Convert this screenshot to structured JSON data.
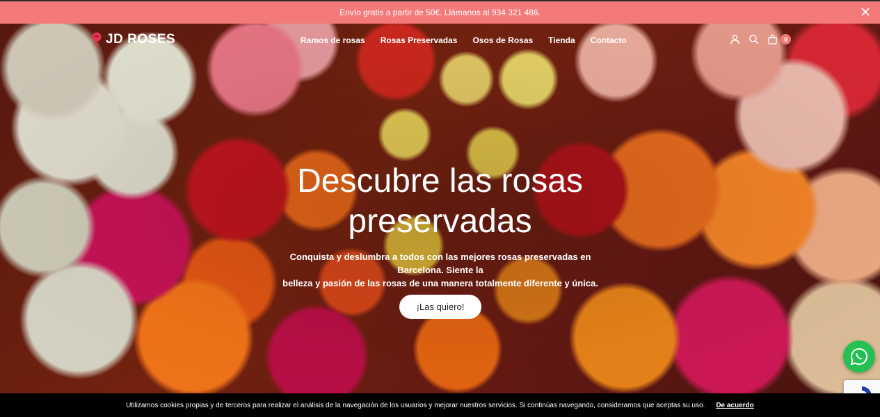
{
  "topbar": {
    "text": "Envío gratis a partir de 50€. Llámanos al 934 321 486."
  },
  "header": {
    "logo_text": "JD ROSES",
    "nav": [
      {
        "label": "Ramos de rosas"
      },
      {
        "label": "Rosas Preservadas"
      },
      {
        "label": "Osos de Rosas"
      },
      {
        "label": "Tienda"
      },
      {
        "label": "Contacto"
      }
    ],
    "cart_count": "0"
  },
  "hero": {
    "title_line1": "Descubre las rosas",
    "title_line2": "preservadas",
    "subtitle_line1": "Conquista y deslumbra a todos con las mejores rosas preservadas en Barcelona. Siente la",
    "subtitle_line2": "belleza y pasión de las rosas de una manera totalmente diferente y única.",
    "cta_label": "¡Las quiero!"
  },
  "cookie": {
    "text": "Utilizamos cookies propias y de terceros para realizar el análisis de la navegación de los usuarios y mejorar nuestros servicios. Si continúas navegando, consideramos que aceptas su uso.",
    "accept_label": "De acuerdo"
  },
  "colors": {
    "topbar_bg": "#f47a7a",
    "cookie_bg": "#000000",
    "whatsapp": "#25c052",
    "cart_badge": "#f47a7a"
  },
  "icons": [
    "rose-logo-icon",
    "close-icon",
    "user-icon",
    "search-icon",
    "cart-icon",
    "whatsapp-icon",
    "recaptcha-icon"
  ]
}
